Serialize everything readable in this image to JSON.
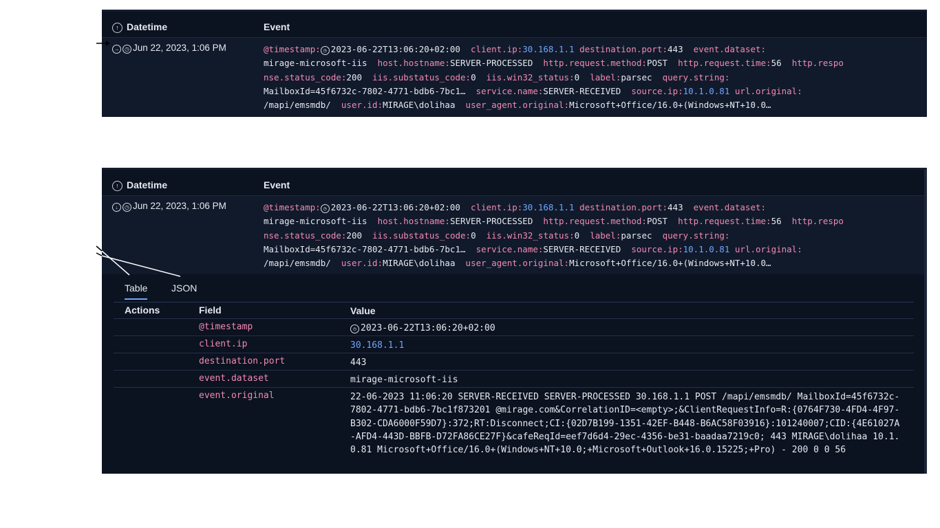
{
  "top_panel": {
    "header": {
      "datetime": "Datetime",
      "event": "Event"
    },
    "row": {
      "date": "Jun 22, 2023, 1:06 PM",
      "line1": [
        {
          "k": "@timestamp:",
          "v": "",
          "t": "k"
        },
        {
          "k": "",
          "v": "2023-06-22T13:06:20+02:00",
          "t": "v",
          "clock": true
        },
        {
          "k": "client.ip:",
          "v": "30.168.1.1",
          "t": "ip"
        },
        {
          "k": "destination.port:",
          "v": "443",
          "t": "v"
        },
        {
          "k": "event.dataset:",
          "v": "",
          "t": "v"
        }
      ]
    }
  },
  "bottom_panel": {
    "header": {
      "datetime": "Datetime",
      "event": "Event"
    },
    "row": {
      "date": "Jun 22, 2023, 1:06 PM"
    },
    "tabs": [
      "Table",
      "JSON"
    ],
    "detail_header": {
      "actions": "Actions",
      "field": "Field",
      "value": "Value"
    },
    "detail_rows": [
      {
        "field": "@timestamp",
        "value": "2023-06-22T13:06:20+02:00"
      },
      {
        "field": "client.ip",
        "value": "30.168.1.1"
      },
      {
        "field": "destination.port",
        "value": "443"
      },
      {
        "field": "event.dataset",
        "value": "mirage-microsoft-iis"
      },
      {
        "field": "event.original",
        "value": "22-06-2023 11:06:20 SERVER-RECEIVED SERVER-PROCESSED 30.168.1.1 POST /mapi/emsmdb/ MailboxId=45f6732c-7802-4771-bdb6-7bc1f873201 @mirage.com&CorrelationID=<empty>;&ClientRequestInfo=R:{0764F730-4FD4-4F97-B302-CDA6000F59D7}:372;RT:Disconnect;CI:{02D7B199-1351-42EF-B448-B6AC58F03916}:101240007;CID:{4E61027A-AFD4-443D-BBFB-D72FA86CE27F}&cafeReqId=eef7d6d4-29ec-4356-be31-baadaa7219c0; 443 MIRAGE\\dolihaa 10.1.0.81 Microsoft+Office/16.0+(Windows+NT+10.0;+Microsoft+Outlook+16.0.15225;+Pro) - 200 0 0 56"
      }
    ]
  },
  "event_text": {
    "timestamp_key": "@timestamp:",
    "timestamp": "2023-06-22T13:06:20+02:00",
    "client_ip_key": "client.ip:",
    "client_ip": "30.168.1.1",
    "dport_key": "destination.port:",
    "dport": "443",
    "dataset_key": "event.dataset:",
    "dataset_top": "mirage-microsoft-iis",
    "hostname_key": "host.hostname:",
    "hostname": "SERVER-PROCESSED",
    "method_key": "http.request.method:",
    "method": "POST",
    "rtime_key": "http.request.time:",
    "rtime": "56",
    "respo_key": "http.respo",
    "status_key": "nse.status_code:",
    "status": "200",
    "substatus_key": "iis.substatus_code:",
    "substatus": "0",
    "win32_key": "iis.win32_status:",
    "win32": "0",
    "label_key": "label:",
    "label": "parsec",
    "query_key": "query.string:",
    "query": "MailboxId=45f6732c-7802-4771-bdb6-7bc1…",
    "service_key": "service.name:",
    "service": "SERVER-RECEIVED",
    "sip_key": "source.ip:",
    "sip": "10.1.0.81",
    "url_key": "url.original:",
    "url": "/mapi/emsmdb/",
    "user_key": "user.id:",
    "user": "MIRAGE\\dolihaa",
    "ua_key": "user_agent.original:",
    "ua": "Microsoft+Office/16.0+(Windows+NT+10.0…"
  }
}
